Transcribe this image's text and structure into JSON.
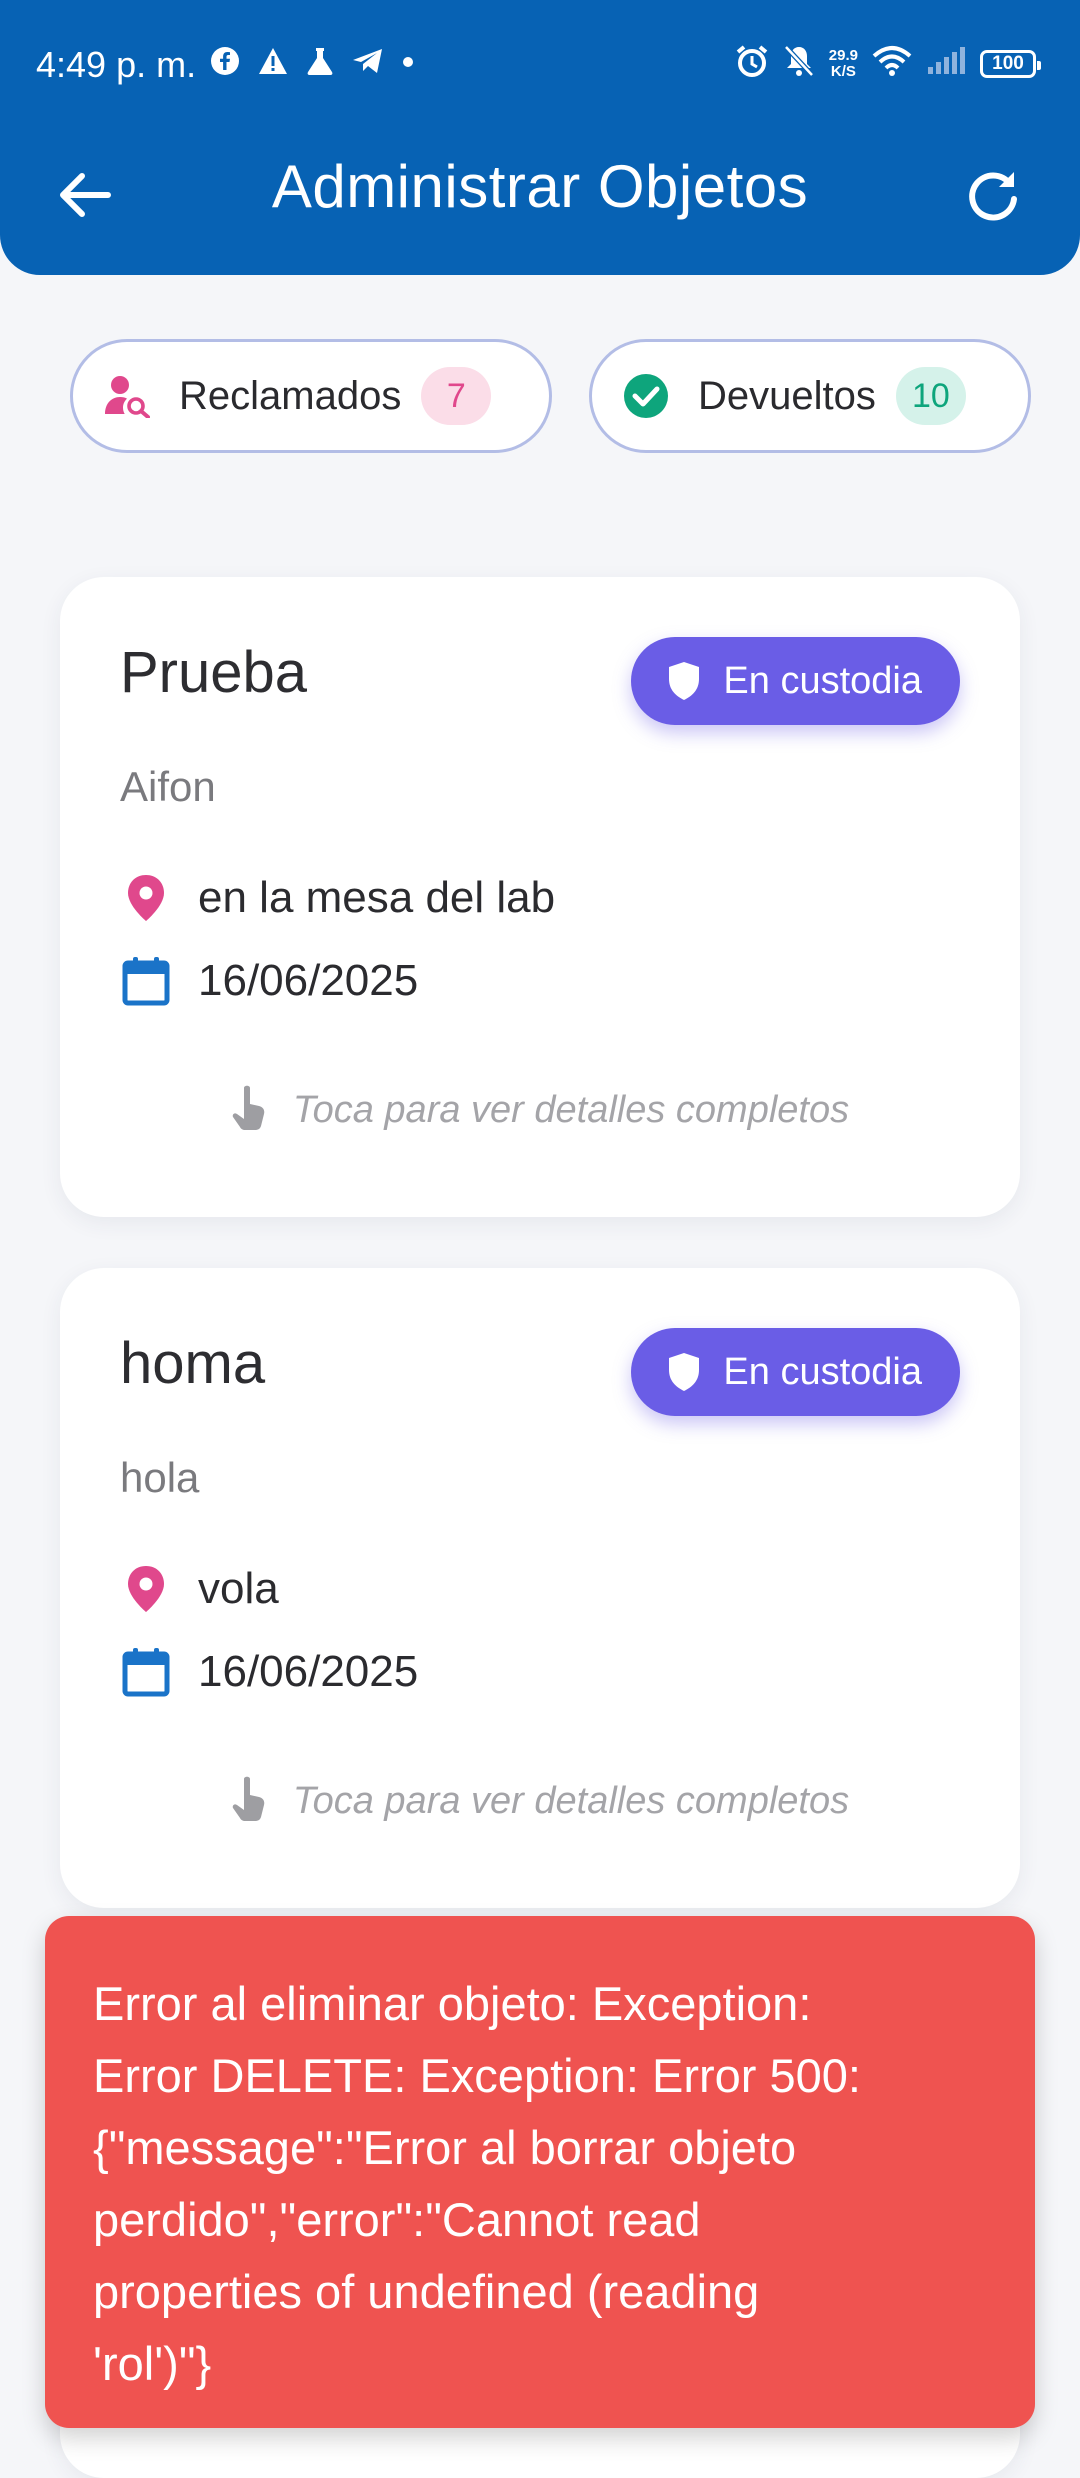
{
  "status_bar": {
    "time": "4:49 p. m.",
    "network_speed_value": "29.9",
    "network_speed_unit": "K/S",
    "battery": "100",
    "left_icons": [
      "facebook-icon",
      "warning-icon",
      "flask-icon",
      "telegram-icon",
      "dot-icon"
    ],
    "right_icons": [
      "alarm-icon",
      "bell-off-icon",
      "wifi-icon",
      "signal-icon",
      "battery-icon"
    ]
  },
  "app_bar": {
    "title": "Administrar Objetos",
    "back_icon": "arrow-left-icon",
    "refresh_icon": "refresh-icon",
    "background": "#0762b4"
  },
  "filters": [
    {
      "label": "Reclamados",
      "count": "7",
      "icon": "user-search-icon",
      "accent": "#e0488c"
    },
    {
      "label": "Devueltos",
      "count": "10",
      "icon": "check-circle-icon",
      "accent": "#0ea57c"
    }
  ],
  "items": [
    {
      "title": "Prueba",
      "status": "En custodia",
      "description": "Aifon",
      "location": "en la mesa del lab",
      "date": "16/06/2025",
      "hint": "Toca para ver detalles completos"
    },
    {
      "title": "homa",
      "status": "En custodia",
      "description": "hola",
      "location": "vola",
      "date": "16/06/2025",
      "hint": "Toca para ver detalles completos"
    }
  ],
  "colors": {
    "status_badge": "#6a5de6",
    "location_pin": "#e0488c",
    "calendar": "#1a73c8",
    "error": "#ef5350"
  },
  "error_snackbar": {
    "lines": [
      "Error al eliminar objeto: Exception:",
      "Error DELETE: Exception: Error 500:",
      "{\"message\":\"Error al borrar objeto",
      "perdido\",\"error\":\"Cannot read",
      "properties of undefined (reading",
      "'rol')\"}"
    ]
  }
}
